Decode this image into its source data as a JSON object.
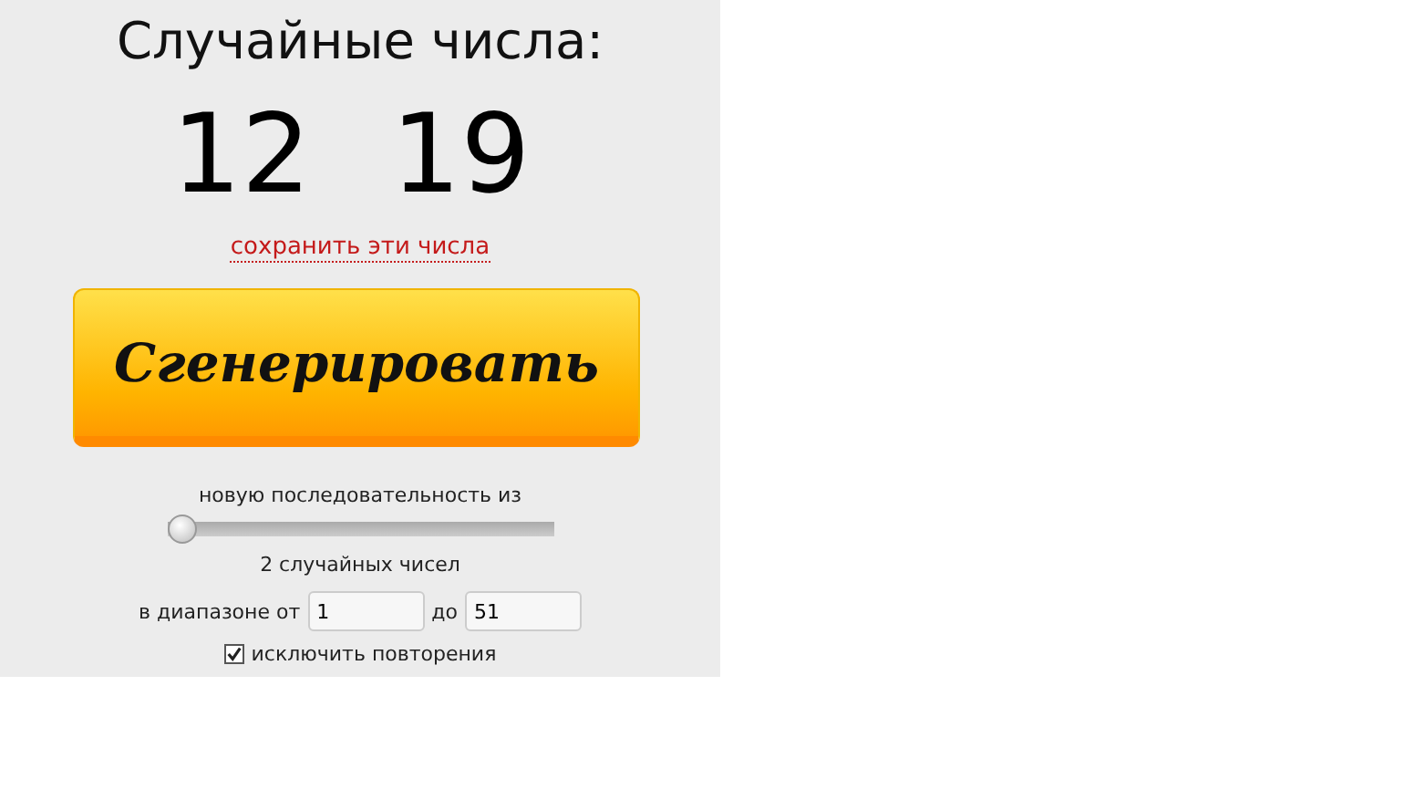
{
  "title": "Случайные числа:",
  "numbers": [
    "12",
    "19"
  ],
  "save_link": "сохранить эти числа",
  "generate_button": "Сгенерировать",
  "sequence_label": "новую последовательность из",
  "count_slider": {
    "level": 0
  },
  "count_label": "2 случайных чисел",
  "range": {
    "from_label": "в диапазоне от",
    "from_value": "1",
    "to_label": "до",
    "to_value": "51"
  },
  "exclude_repeats": {
    "label": "исключить повторения",
    "checked": true
  }
}
